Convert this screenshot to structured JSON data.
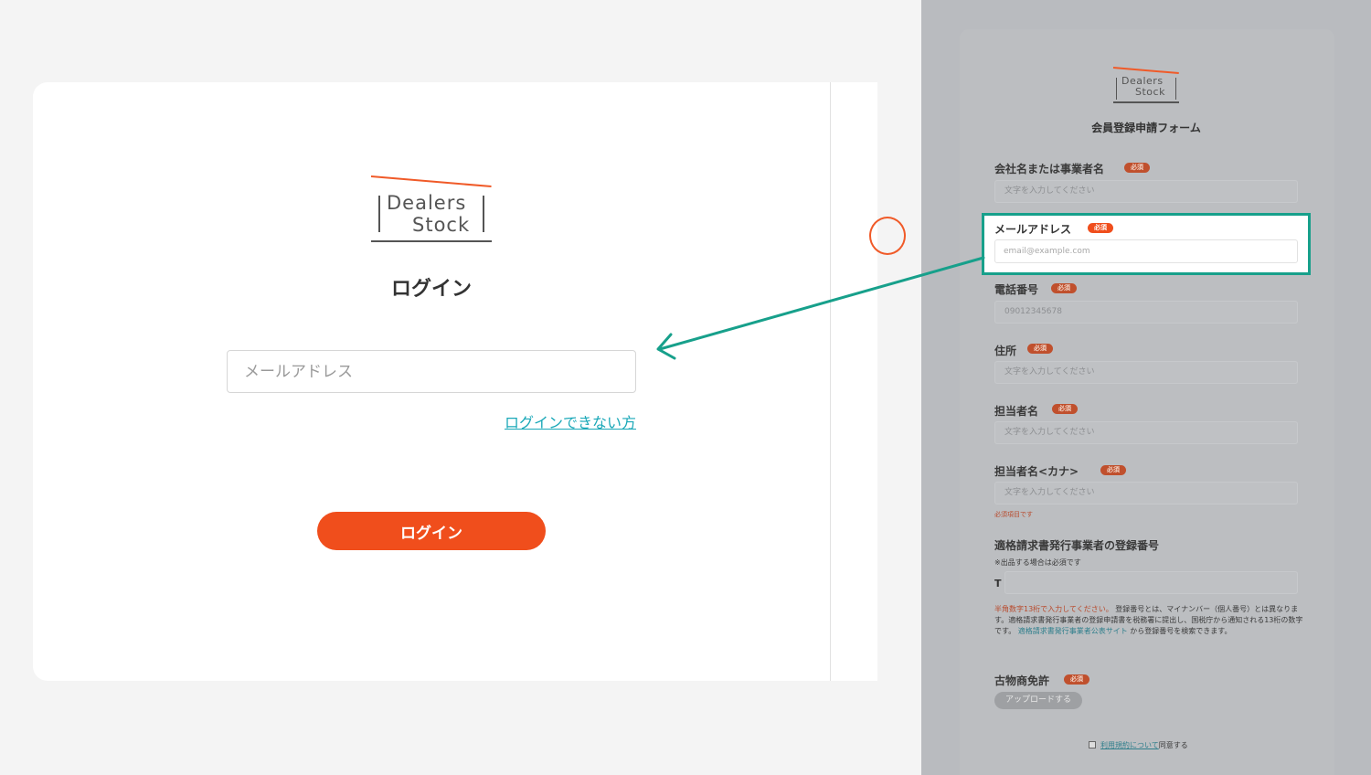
{
  "logo": {
    "line1": "Dealers",
    "line2": "Stock"
  },
  "login": {
    "title": "ログイン",
    "email_placeholder": "メールアドレス",
    "forgot_link": "ログインできない方",
    "submit_label": "ログイン"
  },
  "register": {
    "title": "会員登録申請フォーム",
    "required_badge": "必須",
    "fields": {
      "company": {
        "label": "会社名または事業者名",
        "placeholder": "文字を入力してください"
      },
      "email": {
        "label": "メールアドレス",
        "placeholder": "email@example.com"
      },
      "phone": {
        "label": "電話番号",
        "placeholder": "09012345678"
      },
      "address": {
        "label": "住所",
        "placeholder": "文字を入力してください"
      },
      "contact": {
        "label": "担当者名",
        "placeholder": "文字を入力してください"
      },
      "contact_kana": {
        "label": "担当者名<カナ>",
        "placeholder": "文字を入力してください",
        "error": "必須項目です"
      }
    },
    "invoice": {
      "label": "適格請求書発行事業者の登録番号",
      "note": "※出品する場合は必須です",
      "prefix": "T",
      "help_warn": "半角数字13桁で入力してください。",
      "help_text_1": "登録番号とは、マイナンバー（個人番号）とは異なります。適格請求書発行事業者の登録申請書を税務署に提出し、国税庁から通知される13桁の数字です。",
      "help_link": "適格請求書発行事業者公表サイト",
      "help_text_2": "から登録番号を検索できます。"
    },
    "license": {
      "label": "古物商免許",
      "upload_label": "アップロードする"
    },
    "agree": {
      "link": "利用規約について",
      "suffix": "同意する"
    }
  },
  "colors": {
    "accent": "#f04e1c",
    "teal_link": "#1aa8b8",
    "highlight": "#17a08b",
    "overlay": "#b9bbbf"
  }
}
